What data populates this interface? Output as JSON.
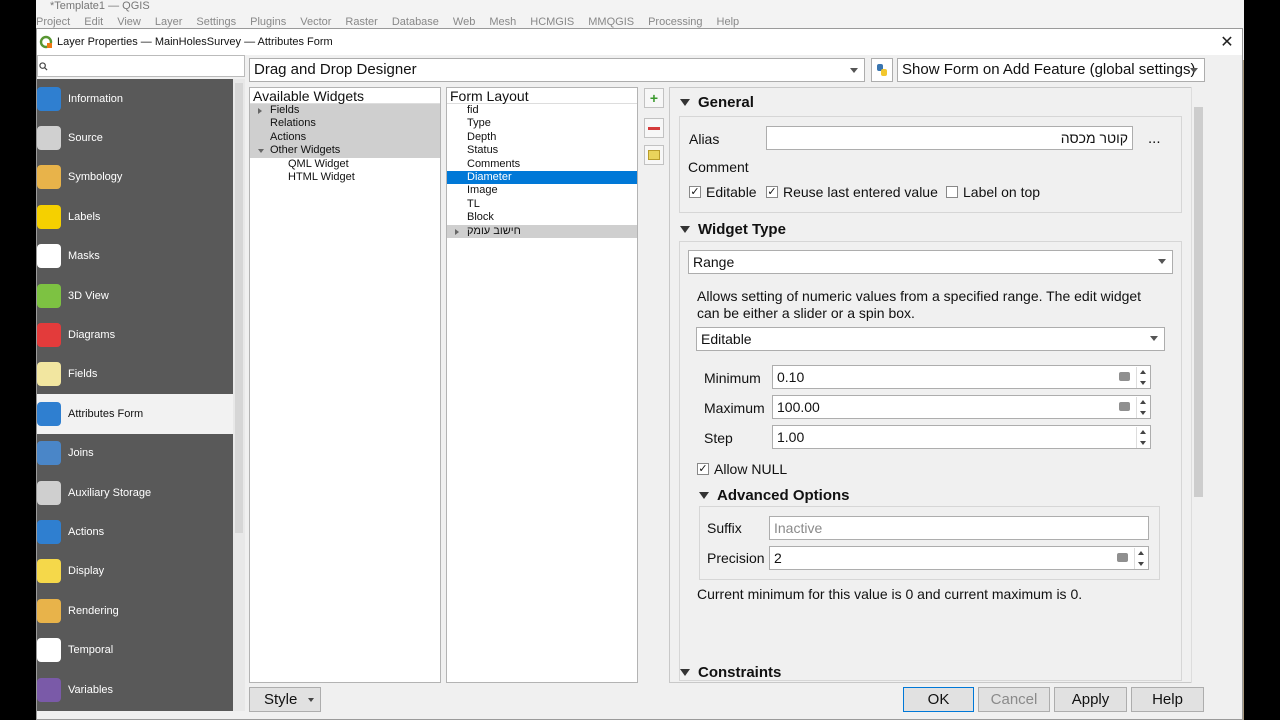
{
  "app": {
    "window_title": "*Template1 — QGIS",
    "menu": [
      "Project",
      "Edit",
      "View",
      "Layer",
      "Settings",
      "Plugins",
      "Vector",
      "Raster",
      "Database",
      "Web",
      "Mesh",
      "HCMGIS",
      "MMQGIS",
      "Processing",
      "Help"
    ]
  },
  "dialog": {
    "title": "Layer Properties — MainHolesSurvey — Attributes Form"
  },
  "sidebar": {
    "items": [
      {
        "label": "Information",
        "icon": "info-icon",
        "color": "#2f7fd0"
      },
      {
        "label": "Source",
        "icon": "source-icon",
        "color": "#d0d0d0"
      },
      {
        "label": "Symbology",
        "icon": "symbology-icon",
        "color": "#e8b34a"
      },
      {
        "label": "Labels",
        "icon": "labels-icon",
        "color": "#f5d000"
      },
      {
        "label": "Masks",
        "icon": "masks-icon",
        "color": "#ffffff"
      },
      {
        "label": "3D View",
        "icon": "3d-view-icon",
        "color": "#7dc242"
      },
      {
        "label": "Diagrams",
        "icon": "diagrams-icon",
        "color": "#e33b3b"
      },
      {
        "label": "Fields",
        "icon": "fields-icon",
        "color": "#f2e6a0"
      },
      {
        "label": "Attributes Form",
        "icon": "attributes-form-icon",
        "color": "#2f7fd0"
      },
      {
        "label": "Joins",
        "icon": "joins-icon",
        "color": "#4a86c8"
      },
      {
        "label": "Auxiliary Storage",
        "icon": "auxiliary-storage-icon",
        "color": "#cfcfcf"
      },
      {
        "label": "Actions",
        "icon": "actions-icon",
        "color": "#2f7fd0"
      },
      {
        "label": "Display",
        "icon": "display-icon",
        "color": "#f5d84a"
      },
      {
        "label": "Rendering",
        "icon": "rendering-icon",
        "color": "#e8b34a"
      },
      {
        "label": "Temporal",
        "icon": "temporal-icon",
        "color": "#ffffff"
      },
      {
        "label": "Variables",
        "icon": "variables-icon",
        "color": "#7a5aa8"
      }
    ],
    "active_index": 8
  },
  "toolbar": {
    "designer_mode": "Drag and Drop Designer",
    "suppress_form": "Show Form on Add Feature (global settings)"
  },
  "available_widgets": {
    "header": "Available Widgets",
    "items": [
      {
        "label": "Fields",
        "level": 0,
        "toggle": "collapsed",
        "style": "gray"
      },
      {
        "label": "Relations",
        "level": 0,
        "toggle": "none",
        "style": "gray"
      },
      {
        "label": "Actions",
        "level": 0,
        "toggle": "none",
        "style": "gray"
      },
      {
        "label": "Other Widgets",
        "level": 0,
        "toggle": "expanded",
        "style": "gray"
      },
      {
        "label": "QML Widget",
        "level": 1,
        "toggle": "none",
        "style": "none"
      },
      {
        "label": "HTML Widget",
        "level": 1,
        "toggle": "none",
        "style": "none"
      }
    ]
  },
  "form_layout": {
    "header": "Form Layout",
    "items": [
      {
        "label": "fid",
        "toggle": "none",
        "style": "none"
      },
      {
        "label": "Type",
        "toggle": "none",
        "style": "none"
      },
      {
        "label": "Depth",
        "toggle": "none",
        "style": "none"
      },
      {
        "label": "Status",
        "toggle": "none",
        "style": "none"
      },
      {
        "label": "Comments",
        "toggle": "none",
        "style": "none"
      },
      {
        "label": "Diameter",
        "toggle": "none",
        "style": "blue"
      },
      {
        "label": "Image",
        "toggle": "none",
        "style": "none"
      },
      {
        "label": "TL",
        "toggle": "none",
        "style": "none"
      },
      {
        "label": "Block",
        "toggle": "none",
        "style": "none"
      },
      {
        "label": "חישוב עומק",
        "toggle": "collapsed",
        "style": "gray"
      }
    ]
  },
  "general": {
    "title": "General",
    "alias_label": "Alias",
    "alias_value": "קוטר מכסה",
    "comment_label": "Comment",
    "editable_label": "Editable",
    "reuse_label": "Reuse last entered value",
    "label_on_top_label": "Label on top",
    "more_label": "..."
  },
  "widget_type": {
    "title": "Widget Type",
    "type_value": "Range",
    "description": "Allows setting of numeric values from a specified range. The edit widget can be either a slider or a spin box.",
    "editor_value": "Editable",
    "minimum_label": "Minimum",
    "minimum_value": "0.10",
    "maximum_label": "Maximum",
    "maximum_value": "100.00",
    "step_label": "Step",
    "step_value": "1.00",
    "allow_null_label": "Allow NULL",
    "advanced_title": "Advanced Options",
    "suffix_label": "Suffix",
    "suffix_placeholder": "Inactive",
    "precision_label": "Precision",
    "precision_value": "2",
    "info_text": "Current minimum for this value is 0 and current maximum is 0."
  },
  "constraints": {
    "title": "Constraints"
  },
  "footer": {
    "style_label": "Style",
    "ok_label": "OK",
    "cancel_label": "Cancel",
    "apply_label": "Apply",
    "help_label": "Help"
  }
}
